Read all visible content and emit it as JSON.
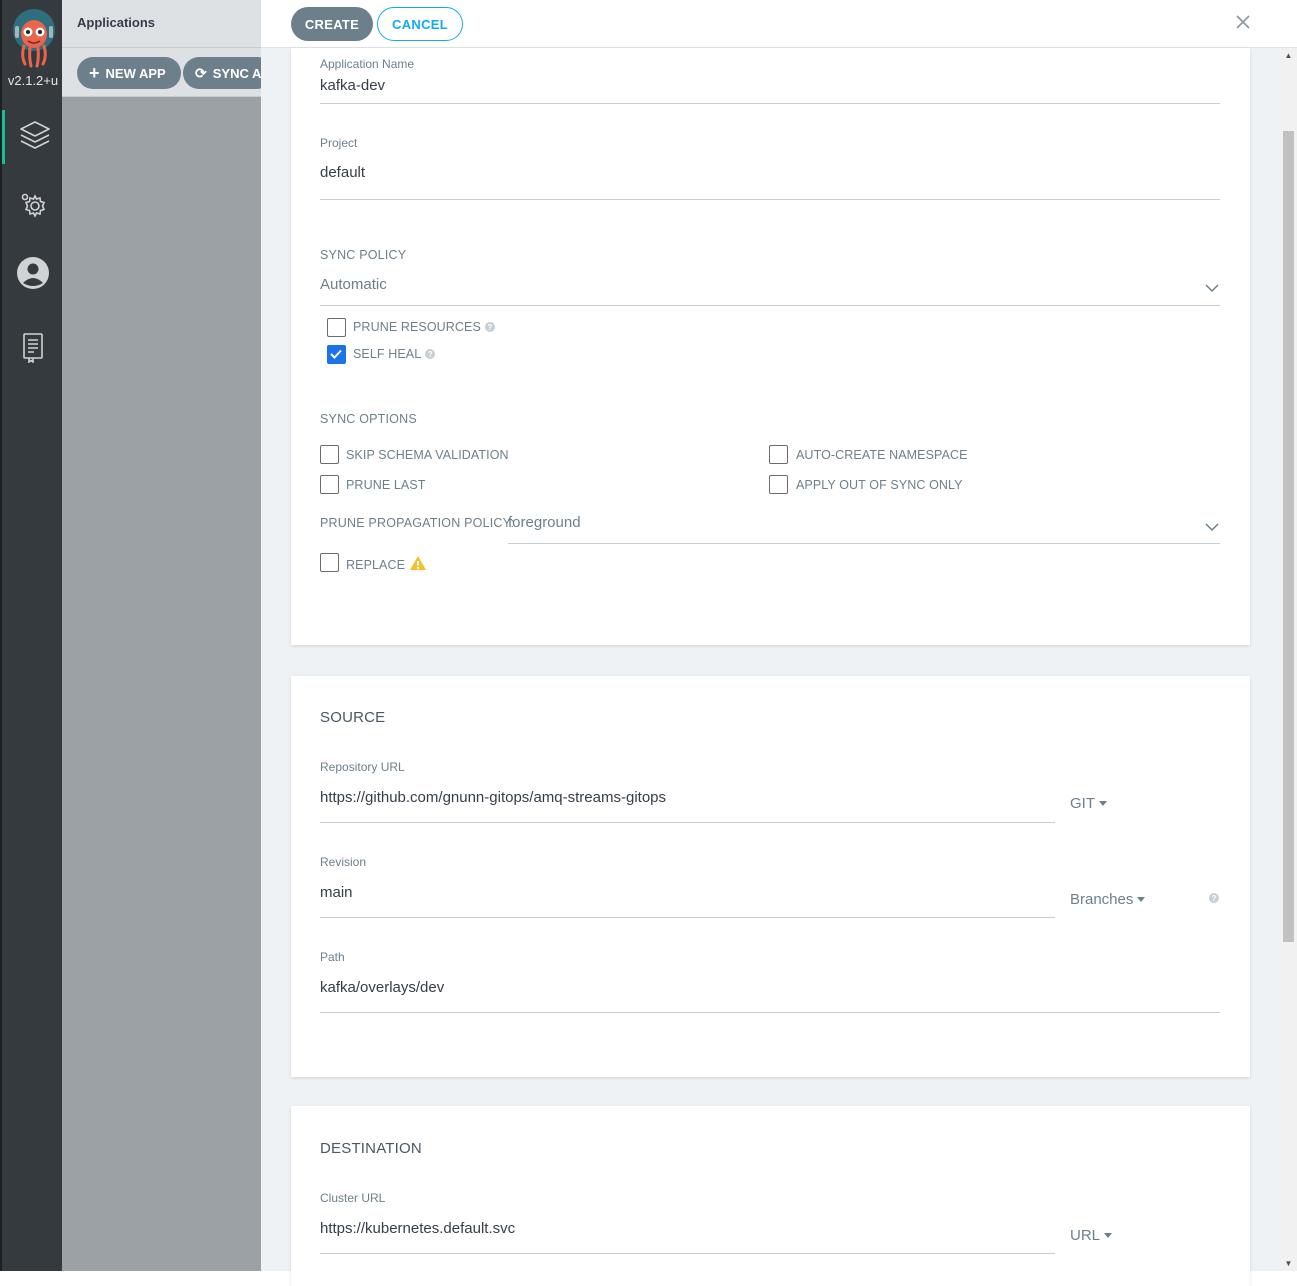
{
  "nav": {
    "version": "v2.1.2+u",
    "items": [
      {
        "icon": "layers-icon"
      },
      {
        "icon": "gears-icon"
      },
      {
        "icon": "user-icon"
      },
      {
        "icon": "docs-icon"
      }
    ]
  },
  "background": {
    "title": "Applications",
    "new_app_label": "NEW APP",
    "sync_label": "SYNC APPS"
  },
  "header": {
    "create_label": "CREATE",
    "cancel_label": "CANCEL"
  },
  "general": {
    "app_name_label": "Application Name",
    "app_name_value": "kafka-dev",
    "project_label": "Project",
    "project_value": "default",
    "sync_policy_label": "SYNC POLICY",
    "sync_policy_value": "Automatic",
    "prune_resources_label": "PRUNE RESOURCES",
    "prune_resources_checked": false,
    "self_heal_label": "SELF HEAL",
    "self_heal_checked": true,
    "sync_options_label": "SYNC OPTIONS",
    "options": {
      "skip_schema": "SKIP SCHEMA VALIDATION",
      "auto_create_ns": "AUTO-CREATE NAMESPACE",
      "prune_last": "PRUNE LAST",
      "apply_out_of_sync": "APPLY OUT OF SYNC ONLY",
      "replace": "REPLACE"
    },
    "prune_propagation_label": "PRUNE PROPAGATION POLICY:",
    "prune_propagation_value": "foreground"
  },
  "source": {
    "title": "SOURCE",
    "repo_label": "Repository URL",
    "repo_value": "https://github.com/gnunn-gitops/amq-streams-gitops",
    "repo_type": "GIT",
    "revision_label": "Revision",
    "revision_value": "main",
    "revision_type": "Branches",
    "path_label": "Path",
    "path_value": "kafka/overlays/dev"
  },
  "destination": {
    "title": "DESTINATION",
    "cluster_label": "Cluster URL",
    "cluster_value": "https://kubernetes.default.svc",
    "cluster_type": "URL"
  }
}
